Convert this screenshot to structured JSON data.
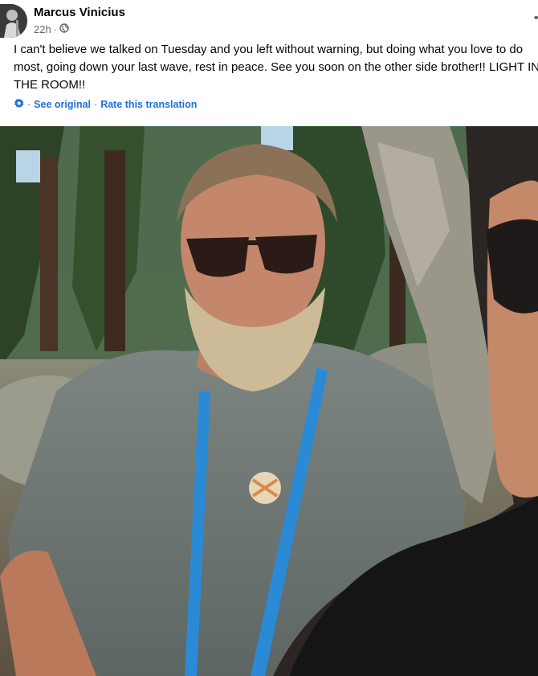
{
  "post": {
    "author": "Marcus Vinicius",
    "time": "22h",
    "privacy_icon": "globe-icon",
    "more_icon": "more-options-icon",
    "text": "I can't believe we talked on Tuesday and you left without warning, but doing what you love to do most, going down your last wave, rest in peace. See you soon on the other side brother!! LIGHT IN THE ROOM!!",
    "translation": {
      "icon": "translate-gear-icon",
      "see_original": "See original",
      "rate": "Rate this translation"
    }
  },
  "colors": {
    "link": "#216fdb",
    "meta": "#65676b",
    "text": "#050505"
  }
}
